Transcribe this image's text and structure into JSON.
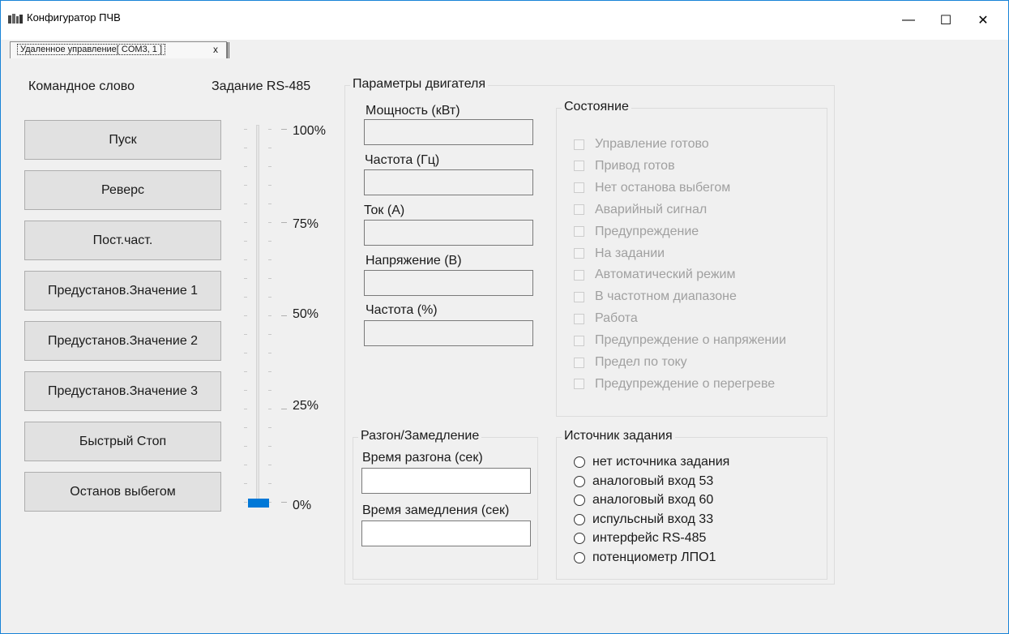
{
  "window": {
    "title": "Конфигуратор ПЧВ",
    "controls": {
      "minimize": "—",
      "maximize": "☐",
      "close": "✕"
    }
  },
  "tab": {
    "label": "Удаленное управление[ COM3, 1 ]",
    "close": "x"
  },
  "command": {
    "heading": "Командное слово",
    "buttons": [
      "Пуск",
      "Реверс",
      "Пост.част.",
      "Предустанов.Значение 1",
      "Предустанов.Значение 2",
      "Предустанов.Значение 3",
      "Быстрый Стоп",
      "Останов выбегом"
    ]
  },
  "setpoint": {
    "heading": "Задание RS-485",
    "scale_labels": [
      "100%",
      "75%",
      "50%",
      "25%",
      "0%"
    ],
    "value_fraction": 0.0
  },
  "motor": {
    "title": "Параметры двигателя",
    "fields": [
      "Мощность (кВт)",
      "Частота (Гц)",
      "Ток (А)",
      "Напряжение (В)",
      "Частота (%)"
    ]
  },
  "status": {
    "title": "Состояние",
    "items": [
      "Управление готово",
      "Привод готов",
      "Нет останова выбегом",
      "Аварийный сигнал",
      "Предупреждение",
      "На задании",
      "Автоматический режим",
      "В частотном диапазоне",
      "Работа",
      "Предупреждение о напряжении",
      "Предел по току",
      "Предупреждение о перегреве"
    ]
  },
  "ramp": {
    "title": "Разгон/Замедление",
    "accel_label": "Время разгона (сек)",
    "decel_label": "Время замедления (сек)"
  },
  "source": {
    "title": "Источник задания",
    "options": [
      "нет источника задания",
      "аналоговый вход 53",
      "аналоговый вход 60",
      "испульсный вход 33",
      "интерфейс RS-485",
      "потенциометр ЛПО1"
    ]
  },
  "colors": {
    "accent": "#0078d7",
    "button_face": "#e1e1e1",
    "background": "#f0f0f0",
    "disabled_text": "#a0a0a0"
  }
}
